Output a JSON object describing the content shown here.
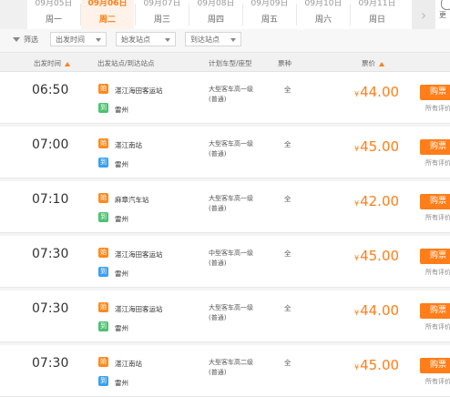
{
  "date_tabs": [
    {
      "date": "09月05日",
      "weekday": "周一",
      "active": false
    },
    {
      "date": "09月06日",
      "weekday": "周二",
      "active": true
    },
    {
      "date": "09月07日",
      "weekday": "周三",
      "active": false
    },
    {
      "date": "09月08日",
      "weekday": "周四",
      "active": false
    },
    {
      "date": "09月09日",
      "weekday": "周五",
      "active": false
    },
    {
      "date": "09月10日",
      "weekday": "周六",
      "active": false
    },
    {
      "date": "09月11日",
      "weekday": "周日",
      "active": false
    }
  ],
  "more_label": "更",
  "next_arrow": "›",
  "filters": {
    "label": "筛选",
    "departure_time": "出发时间",
    "boarding_station": "始发站点",
    "arrival_station": "到达站点"
  },
  "header": {
    "departure_time": "出发时间",
    "stations": "出发站点/到达站点",
    "bus_type": "计划车型/座型",
    "ticket_type": "票种",
    "price": "票价"
  },
  "tags": {
    "from": "始",
    "to": "到"
  },
  "rows": [
    {
      "time": "06:50",
      "from": "湛江海田客运站",
      "to": "雷州",
      "bus_line1": "大型客车高一级",
      "bus_line2": "(普通)",
      "ticket": "全",
      "currency": "¥",
      "price": "44.00",
      "buy": "购票",
      "review": "所有评价"
    },
    {
      "time": "07:00",
      "from": "湛江南站",
      "to": "雷州",
      "bus_line1": "大型客车高一级",
      "bus_line2": "(普通)",
      "ticket": "全",
      "currency": "¥",
      "price": "45.00",
      "buy": "购票",
      "review": "所有评价"
    },
    {
      "time": "07:10",
      "from": "麻章汽车站",
      "to": "雷州",
      "bus_line1": "大型客车高一级",
      "bus_line2": "(普通)",
      "ticket": "全",
      "currency": "¥",
      "price": "42.00",
      "buy": "购票",
      "review": "所有评价"
    },
    {
      "time": "07:30",
      "from": "湛江海田客运站",
      "to": "雷州",
      "bus_line1": "中型客车高一级",
      "bus_line2": "(普通)",
      "ticket": "全",
      "currency": "¥",
      "price": "45.00",
      "buy": "购票",
      "review": "所有评价"
    },
    {
      "time": "07:30",
      "from": "湛江海田客运站",
      "to": "雷州",
      "bus_line1": "大型客车高一级",
      "bus_line2": "(普通)",
      "ticket": "全",
      "currency": "¥",
      "price": "44.00",
      "buy": "购票",
      "review": "所有评价"
    },
    {
      "time": "07:30",
      "from": "湛江南站",
      "to": "雷州",
      "bus_line1": "大型客车高二级",
      "bus_line2": "(普通)",
      "ticket": "全",
      "currency": "¥",
      "price": "45.00",
      "buy": "购票",
      "review": "所有评价"
    }
  ],
  "colors": {
    "accent": "#ff7e1a",
    "from_tag": "#ff8a1d",
    "to_tag": "#4cc26f",
    "to_tag_alt": "#3aa0f0"
  }
}
